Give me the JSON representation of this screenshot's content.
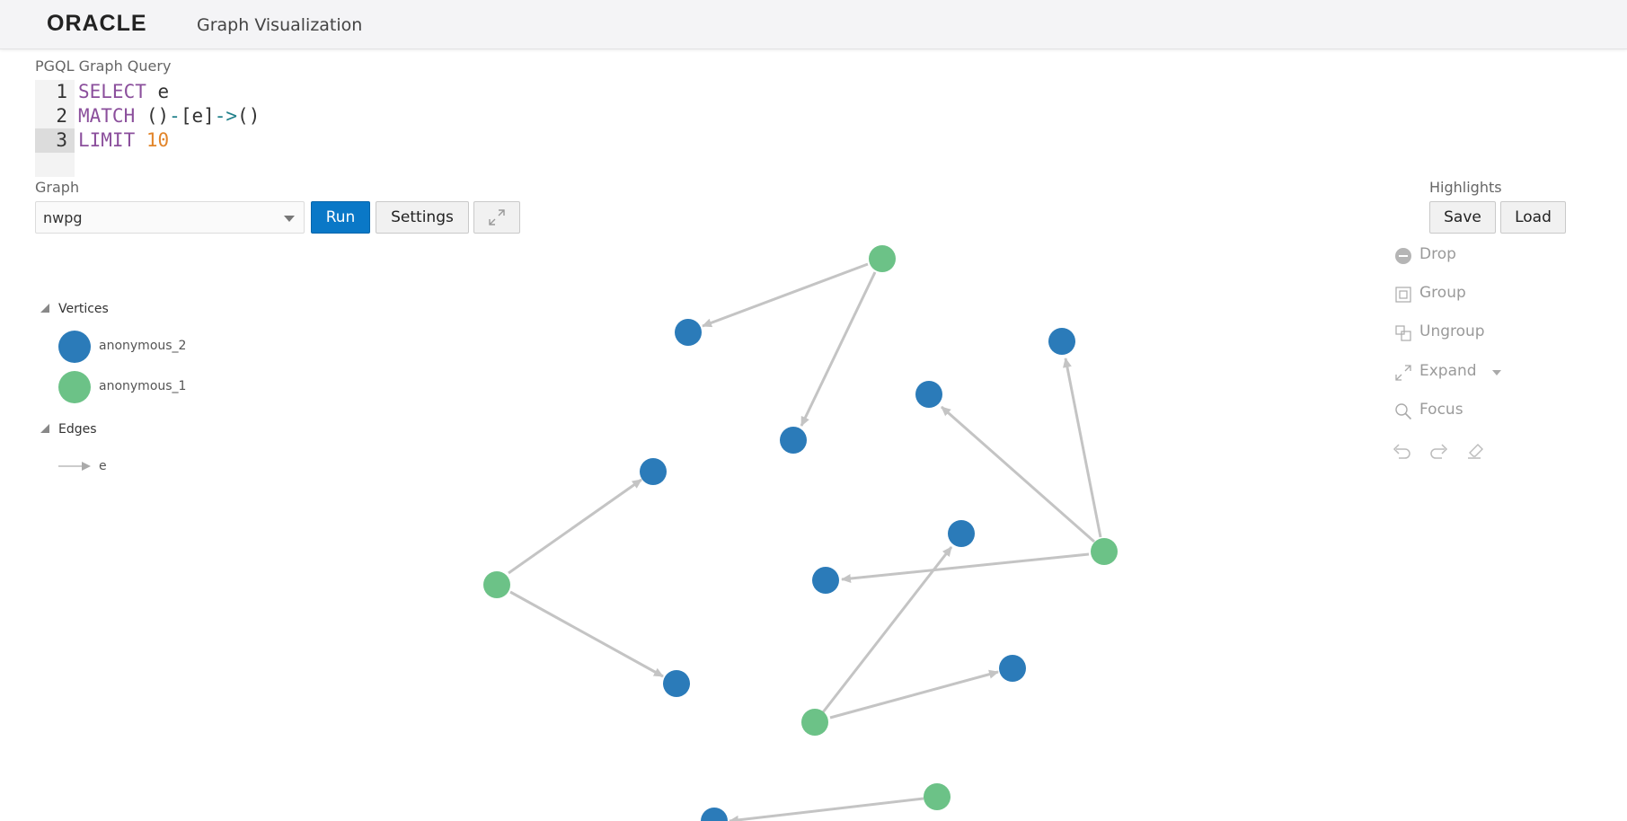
{
  "app": {
    "brand": "ORACLE",
    "title": "Graph Visualization"
  },
  "query": {
    "label": "PGQL Graph Query",
    "lines": [
      {
        "num": "1",
        "tokens": [
          {
            "t": "SELECT",
            "c": "kw"
          },
          {
            "t": " e",
            "c": "plain"
          }
        ]
      },
      {
        "num": "2",
        "tokens": [
          {
            "t": "MATCH",
            "c": "kw"
          },
          {
            "t": " ()",
            "c": "plain"
          },
          {
            "t": "-",
            "c": "op"
          },
          {
            "t": "[e]",
            "c": "plain"
          },
          {
            "t": "->",
            "c": "op"
          },
          {
            "t": "()",
            "c": "plain"
          }
        ]
      },
      {
        "num": "3",
        "tokens": [
          {
            "t": "LIMIT",
            "c": "kw"
          },
          {
            "t": " ",
            "c": "plain"
          },
          {
            "t": "10",
            "c": "num"
          }
        ]
      }
    ]
  },
  "graph_select": {
    "label": "Graph",
    "value": "nwpg"
  },
  "buttons": {
    "run": "Run",
    "settings": "Settings"
  },
  "highlights": {
    "label": "Highlights",
    "save": "Save",
    "load": "Load"
  },
  "tools": {
    "drop": "Drop",
    "group": "Group",
    "ungroup": "Ungroup",
    "expand": "Expand",
    "focus": "Focus"
  },
  "legend": {
    "vertices_label": "Vertices",
    "vertices": [
      {
        "label": "anonymous_2",
        "color": "#2b7bb9"
      },
      {
        "label": "anonymous_1",
        "color": "#6cc287"
      }
    ],
    "edges_label": "Edges",
    "edges": [
      {
        "label": "e"
      }
    ]
  },
  "colors": {
    "source_vertex": "#6cc287",
    "target_vertex": "#2b7bb9",
    "edge": "#c4c4c4",
    "accent": "#0a78c7"
  }
}
